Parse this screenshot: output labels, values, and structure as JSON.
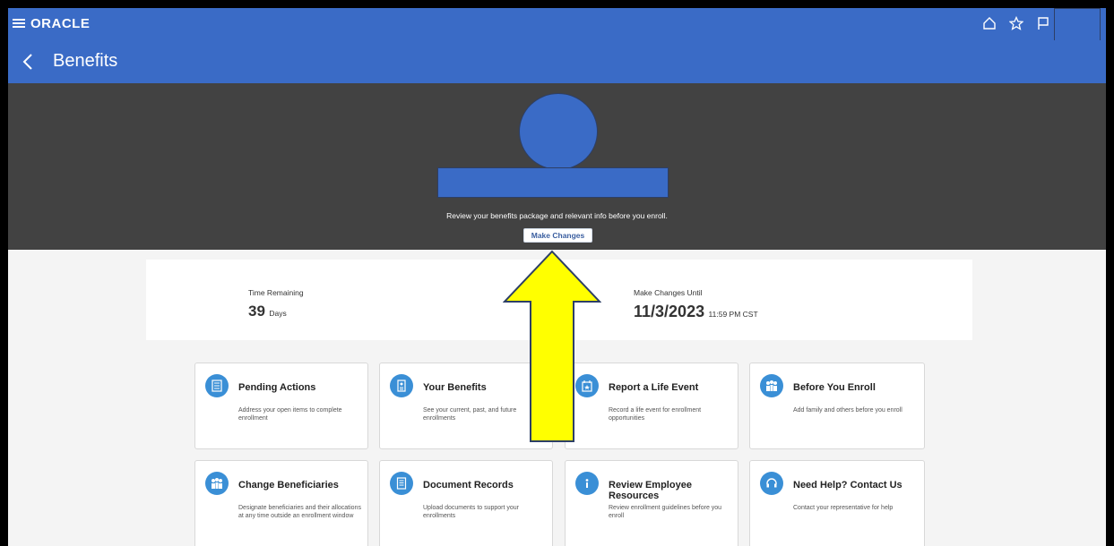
{
  "header": {
    "logo_text": "ORACLE",
    "icons": [
      "hamburger-icon",
      "home-icon",
      "star-icon",
      "flag-icon"
    ]
  },
  "titlebar": {
    "title": "Benefits"
  },
  "hero": {
    "message": "Review your benefits package and relevant info before you enroll.",
    "button_label": "Make Changes"
  },
  "summary": {
    "time_remaining_label": "Time Remaining",
    "time_remaining_value": "39",
    "time_remaining_unit": "Days",
    "make_changes_until_label": "Make Changes Until",
    "make_changes_until_date": "11/3/2023",
    "make_changes_until_time": "11:59 PM CST"
  },
  "tiles": [
    {
      "title": "Pending Actions",
      "desc": "Address your open items to complete enrollment",
      "icon": "checklist-icon"
    },
    {
      "title": "Your Benefits",
      "desc": "See your current, past, and future enrollments",
      "icon": "badge-icon"
    },
    {
      "title": "Report a Life Event",
      "desc": "Record a life event for enrollment opportunities",
      "icon": "calendar-star-icon"
    },
    {
      "title": "Before You Enroll",
      "desc": "Add family and others before you enroll",
      "icon": "family-icon"
    },
    {
      "title": "Change Beneficiaries",
      "desc": "Designate beneficiaries and their allocations at any time outside an enrollment window",
      "icon": "people-icon"
    },
    {
      "title": "Document Records",
      "desc": "Upload documents to support your enrollments",
      "icon": "document-icon"
    },
    {
      "title": "Review Employee Resources",
      "desc": "Review enrollment guidelines before you enroll",
      "icon": "info-icon"
    },
    {
      "title": "Need Help? Contact Us",
      "desc": "Contact your representative for help",
      "icon": "headset-icon"
    }
  ],
  "colors": {
    "header_blue": "#3a6bc6",
    "hero_gray": "#424242",
    "tile_icon_blue": "#3a8fd6",
    "arrow_yellow": "#ffff00"
  }
}
